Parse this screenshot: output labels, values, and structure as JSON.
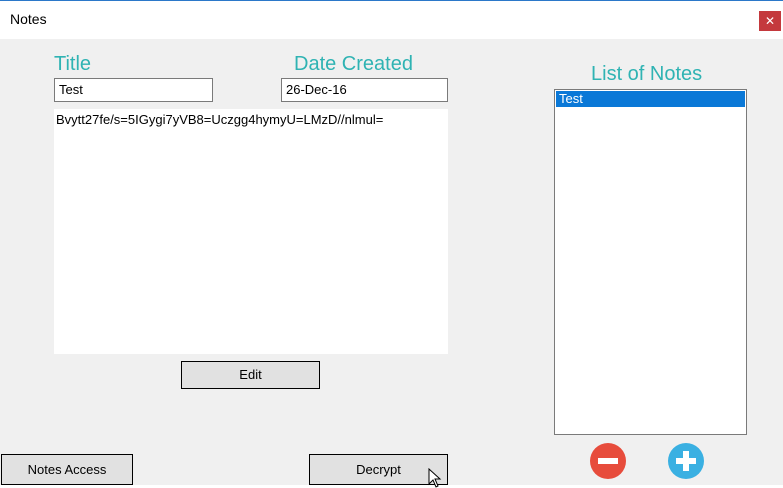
{
  "window": {
    "title": "Notes",
    "close_glyph": "✕"
  },
  "editor": {
    "title_label": "Title",
    "title_value": "Test",
    "date_label": "Date Created",
    "date_value": "26-Dec-16",
    "body_text": "Bvytt27fe/s=5IGygi7yVB8=Uczgg4hymyU=LMzD//nlmul="
  },
  "buttons": {
    "edit": "Edit",
    "notes_access": "Notes Access",
    "decrypt": "Decrypt"
  },
  "notes_list": {
    "label": "List of Notes",
    "items": [
      {
        "label": "Test",
        "selected": true
      }
    ]
  },
  "icons": {
    "remove": "minus-circle-icon",
    "add": "plus-circle-icon",
    "cursor": "mouse-pointer-icon"
  },
  "colors": {
    "accent_teal": "#2fb3b3",
    "selection_blue": "#0a78d7",
    "remove_red": "#e74c3c",
    "add_blue": "#3ab0e2",
    "close_red": "#c4393d"
  }
}
